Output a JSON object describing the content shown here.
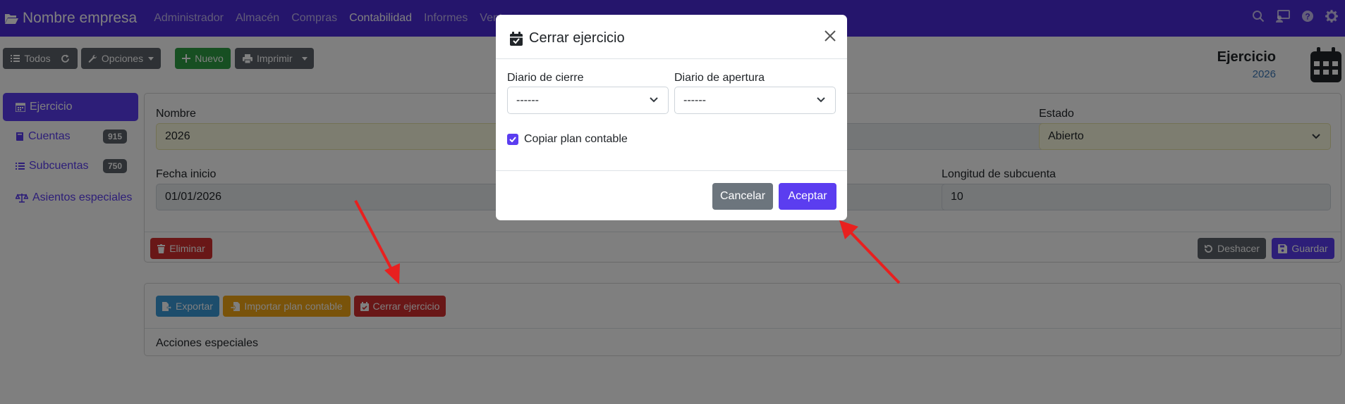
{
  "navbar": {
    "brand": "Nombre empresa",
    "menu": [
      "Administrador",
      "Almacén",
      "Compras",
      "Contabilidad",
      "Informes",
      "Ventas"
    ],
    "active": "Contabilidad",
    "icons": [
      "search-icon",
      "monitor-user-icon",
      "help-icon",
      "gear-icon"
    ]
  },
  "toolbar": {
    "todos": "Todos",
    "opciones": "Opciones",
    "nuevo": "Nuevo",
    "imprimir": "Imprimir"
  },
  "page_title": {
    "title": "Ejercicio",
    "subtitle": "2026",
    "icon": "calendar-icon"
  },
  "sidebar": {
    "items": [
      {
        "label": "Ejercicio",
        "badge": null,
        "icon": "calendar-icon"
      },
      {
        "label": "Cuentas",
        "badge": "915",
        "icon": "book-icon"
      },
      {
        "label": "Subcuentas",
        "badge": "750",
        "icon": "list-icon"
      },
      {
        "label": "Asientos especiales",
        "badge": null,
        "icon": "balance-scale-icon"
      }
    ]
  },
  "form": {
    "nombre_label": "Nombre",
    "nombre_value": "2026",
    "estado_label": "Estado",
    "estado_value": "Abierto",
    "fecha_inicio_label": "Fecha inicio",
    "fecha_inicio_value": "01/01/2026",
    "longitud_label": "Longitud de subcuenta",
    "longitud_value": "10",
    "eliminar": "Eliminar",
    "deshacer": "Deshacer",
    "guardar": "Guardar"
  },
  "actions": {
    "exportar": "Exportar",
    "importar": "Importar plan contable",
    "cerrar": "Cerrar ejercicio",
    "acciones_title": "Acciones especiales"
  },
  "modal": {
    "title": "Cerrar ejercicio",
    "diario_cierre_label": "Diario de cierre",
    "diario_cierre_value": "------",
    "diario_apertura_label": "Diario de apertura",
    "diario_apertura_value": "------",
    "copiar_label": "Copiar plan contable",
    "copiar_checked": true,
    "cancelar": "Cancelar",
    "aceptar": "Aceptar"
  },
  "colors": {
    "navbar": "#4b2bd8",
    "primary": "#5b3df0",
    "danger": "#d32f2f",
    "success": "#2f9e44",
    "annotation_arrow": "#e8201f"
  }
}
